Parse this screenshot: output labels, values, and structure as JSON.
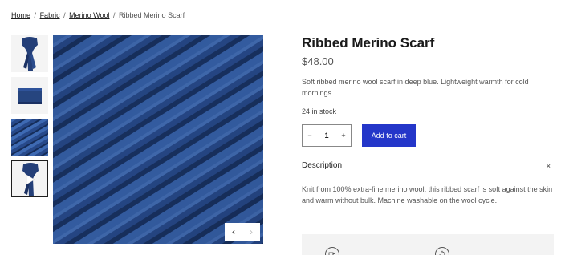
{
  "breadcrumb": {
    "items": [
      "Home",
      "Fabric",
      "Merino Wool"
    ],
    "current": "Ribbed Merino Scarf",
    "separator": "/"
  },
  "gallery": {
    "thumbnails": [
      "scarf-on-hanger",
      "folded-scarf",
      "knit-texture-closeup",
      "scarf-video"
    ],
    "active_index": 3,
    "prev_icon": "chevron-left-icon",
    "next_icon": "chevron-right-icon"
  },
  "product": {
    "title": "Ribbed Merino Scarf",
    "price": "$48.00",
    "short_description": "Soft ribbed merino wool scarf in deep blue. Lightweight warmth for cold mornings.",
    "stock": "24 in stock",
    "quantity": "1",
    "minus": "−",
    "plus": "+",
    "add_to_cart": "Add to cart"
  },
  "description_panel": {
    "label": "Description",
    "close": "×",
    "body": "Knit from 100% extra-fine merino wool, this ribbed scarf is soft against the skin and warm without bulk. Machine washable on the wool cycle."
  },
  "colors": {
    "accent": "#2436c9",
    "wool_blue": "#2d4f8e"
  }
}
